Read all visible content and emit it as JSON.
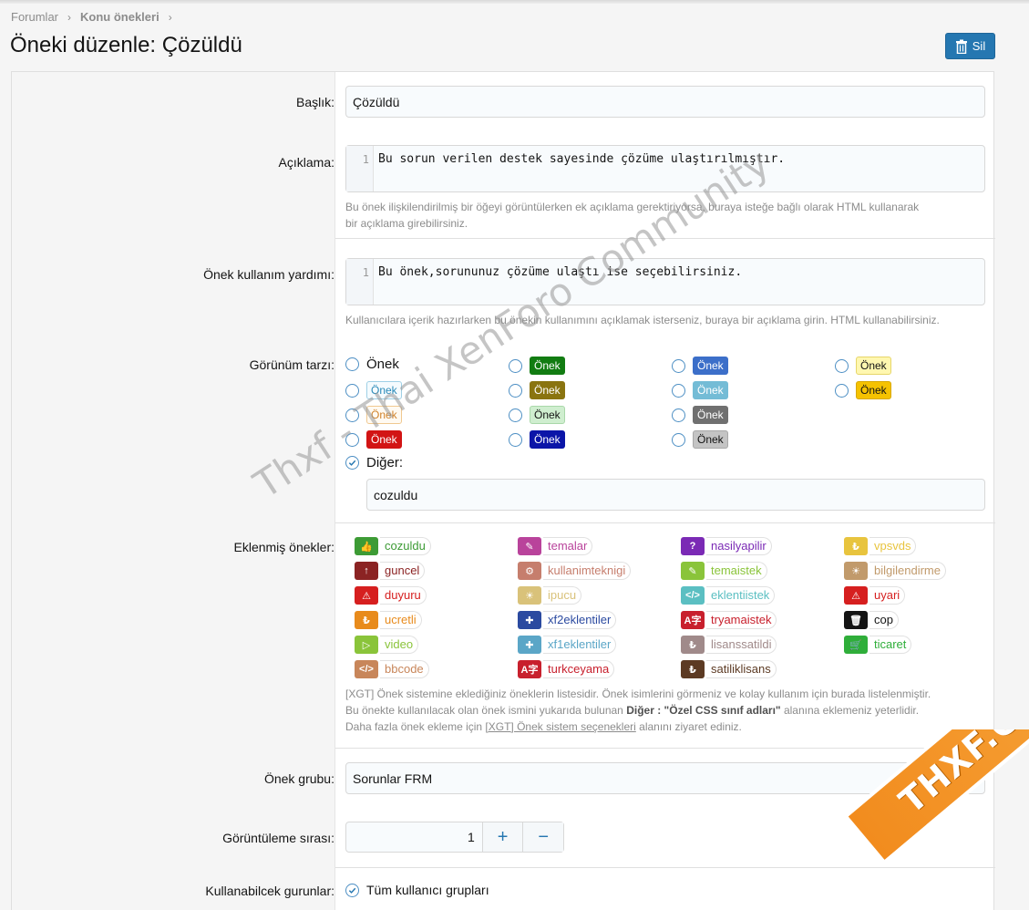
{
  "breadcrumb": [
    {
      "label": "Forumlar"
    },
    {
      "label": "Konu önekleri"
    }
  ],
  "page_title": "Öneki düzenle: Çözüldü",
  "delete_label": "Sil",
  "fields": {
    "title": {
      "label": "Başlık:",
      "value": "Çözüldü"
    },
    "description": {
      "label": "Açıklama:",
      "line_no": "1",
      "value": "Bu sorun verilen destek sayesinde çözüme ulaştırılmıştır.",
      "hint_1": "Bu önek ilişkilendirilmiş bir öğeyi görüntülerken ek açıklama gerektiriyorsa, buraya isteğe bağlı olarak HTML kullanarak",
      "hint_2": "bir açıklama girebilirsiniz."
    },
    "usage_help": {
      "label": "Önek kullanım yardımı:",
      "line_no": "1",
      "value": "Bu önek,sorununuz çözüme ulaştı ise seçebilirsiniz.",
      "hint": "Kullanıcılara içerik hazırlarken bu önekin kullanımını açıklamak isterseniz, buraya bir açıklama girin. HTML kullanabilirsiniz."
    },
    "style": {
      "label": "Görünüm tarzı:",
      "plain_option": "Önek",
      "pill_text": "Önek",
      "other_label": "Diğer:",
      "other_value": "cozuldu"
    },
    "added_prefixes": {
      "label": "Eklenmiş önekler:",
      "hint_1": "[XGT] Önek sistemine eklediğiniz öneklerin listesidir. Önek isimlerini görmeniz ve kolay kullanım için burada listelenmiştir.",
      "hint_2a": "Bu önekte kullanılacak olan önek ismini yukarıda bulunan ",
      "hint_2b": "Diğer : \"Özel CSS sınıf adları\"",
      "hint_2c": " alanına eklemeniz yeterlidir.",
      "hint_3a": "Daha fazla önek ekleme için ",
      "hint_3b": "[XGT] Önek sistem seçenekleri",
      "hint_3c": " alanını ziyaret ediniz."
    },
    "prefix_group": {
      "label": "Önek grubu:",
      "value": "Sorunlar FRM"
    },
    "display_order": {
      "label": "Görüntüleme sırası:",
      "value": "1",
      "plus": "+",
      "minus": "−"
    },
    "usable_groups": {
      "label": "Kullanabilcek gurunlar:",
      "value": "Tüm kullanıcı grupları"
    }
  },
  "prefix_tags": [
    {
      "name": "cozuldu",
      "color": "#3d9b35",
      "icon": "thumbs-up-icon",
      "glyph": "👍"
    },
    {
      "name": "temalar",
      "color": "#b9439b",
      "icon": "brush-icon",
      "glyph": "✎"
    },
    {
      "name": "nasilyapilir",
      "color": "#7b2ab5",
      "icon": "question-icon",
      "glyph": "?"
    },
    {
      "name": "vpsvds",
      "color": "#e8c43e",
      "icon": "lira-icon",
      "glyph": "₺"
    },
    {
      "name": "guncel",
      "color": "#8b2323",
      "icon": "arrow-up-icon",
      "glyph": "↑"
    },
    {
      "name": "kullanimteknigi",
      "color": "#c67e6d",
      "icon": "gear-icon",
      "glyph": "⚙"
    },
    {
      "name": "temaistek",
      "color": "#8ac43a",
      "icon": "brush-icon",
      "glyph": "✎"
    },
    {
      "name": "bilgilendirme",
      "color": "#c19a6b",
      "icon": "lightbulb-icon",
      "glyph": "☀"
    },
    {
      "name": "duyuru",
      "color": "#d61f1f",
      "icon": "warning-icon",
      "glyph": "⚠"
    },
    {
      "name": "ipucu",
      "color": "#d9c27a",
      "icon": "lightbulb-icon",
      "glyph": "☀"
    },
    {
      "name": "eklentiistek",
      "color": "#5bbfc2",
      "icon": "code-icon",
      "glyph": "</>"
    },
    {
      "name": "uyari",
      "color": "#d61f1f",
      "icon": "warning-icon",
      "glyph": "⚠"
    },
    {
      "name": "ucretli",
      "color": "#e88b1c",
      "icon": "lira-icon",
      "glyph": "₺"
    },
    {
      "name": "xf2eklentiler",
      "color": "#2b4aa0",
      "icon": "puzzle-icon",
      "glyph": "✚"
    },
    {
      "name": "tryamaistek",
      "color": "#c8202d",
      "icon": "translate-icon",
      "glyph": "A字"
    },
    {
      "name": "cop",
      "color": "#141414",
      "icon": "trash-icon",
      "glyph": "🗑"
    },
    {
      "name": "video",
      "color": "#8ac43a",
      "icon": "play-icon",
      "glyph": "▷"
    },
    {
      "name": "xf1eklentiler",
      "color": "#5ba6c7",
      "icon": "puzzle-icon",
      "glyph": "✚"
    },
    {
      "name": "lisanssatildi",
      "color": "#a08a8a",
      "icon": "lira-icon",
      "glyph": "₺"
    },
    {
      "name": "ticaret",
      "color": "#2fae3a",
      "icon": "cart-icon",
      "glyph": "🛒"
    },
    {
      "name": "bbcode",
      "color": "#c8865a",
      "icon": "code-icon",
      "glyph": "</>"
    },
    {
      "name": "turkceyama",
      "color": "#c8202d",
      "icon": "translate-icon",
      "glyph": "A字"
    },
    {
      "name": "satiliklisans",
      "color": "#5c3a23",
      "icon": "lira-icon",
      "glyph": "₺"
    }
  ],
  "watermark": {
    "text": "Thxf - Thai XenForo Community",
    "logo": "THXF.ORG"
  }
}
